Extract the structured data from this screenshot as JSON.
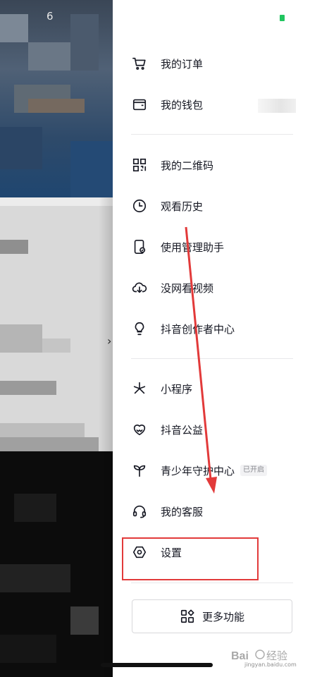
{
  "status_bar": {
    "time_partial": "6"
  },
  "menu": {
    "items": [
      {
        "label": "我的订单",
        "icon": "cart-icon"
      },
      {
        "label": "我的钱包",
        "icon": "wallet-icon"
      },
      {
        "label": "我的二维码",
        "icon": "qr-code-icon"
      },
      {
        "label": "观看历史",
        "icon": "clock-icon"
      },
      {
        "label": "使用管理助手",
        "icon": "phone-shield-icon"
      },
      {
        "label": "没网看视频",
        "icon": "cloud-download-icon"
      },
      {
        "label": "抖音创作者中心",
        "icon": "lightbulb-icon"
      },
      {
        "label": "小程序",
        "icon": "mini-program-icon"
      },
      {
        "label": "抖音公益",
        "icon": "heart-hands-icon"
      },
      {
        "label": "青少年守护中心",
        "icon": "sprout-icon",
        "badge": "已开启"
      },
      {
        "label": "我的客服",
        "icon": "headset-icon"
      },
      {
        "label": "设置",
        "icon": "settings-hexagon-icon"
      }
    ]
  },
  "more_button": {
    "label": "更多功能",
    "icon": "grid-icon"
  },
  "colors": {
    "annotation_red": "#e23a3a",
    "status_green": "#20c55f",
    "text": "#161823"
  },
  "watermark": {
    "brand": "Bai 经验",
    "url": "jingyan.baidu.com"
  }
}
